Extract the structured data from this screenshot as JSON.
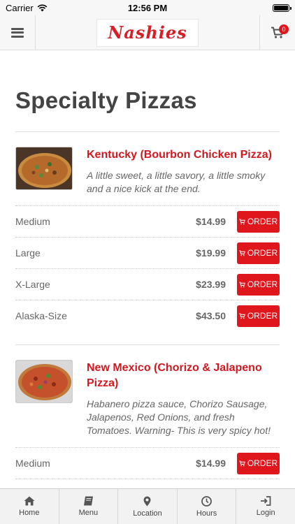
{
  "status_bar": {
    "carrier": "Carrier",
    "time": "12:56 PM"
  },
  "header": {
    "logo_text": "Nashies",
    "cart_count": "0"
  },
  "page": {
    "title": "Specialty Pizzas"
  },
  "items": [
    {
      "name": "Kentucky (Bourbon Chicken Pizza)",
      "description": "A little sweet, a little savory, a little smoky and a nice kick at the end.",
      "sizes": [
        {
          "name": "Medium",
          "price": "$14.99",
          "button": "ORDER"
        },
        {
          "name": "Large",
          "price": "$19.99",
          "button": "ORDER"
        },
        {
          "name": "X-Large",
          "price": "$23.99",
          "button": "ORDER"
        },
        {
          "name": "Alaska-Size",
          "price": "$43.50",
          "button": "ORDER"
        }
      ]
    },
    {
      "name": "New Mexico (Chorizo & Jalapeno Pizza)",
      "description": "Habanero pizza sauce, Chorizo Sausage, Jalapenos, Red Onions, and fresh Tomatoes. Warning- This is very spicy hot!",
      "sizes": [
        {
          "name": "Medium",
          "price": "$14.99",
          "button": "ORDER"
        }
      ]
    }
  ],
  "tabs": [
    {
      "label": "Home",
      "icon": "home-icon"
    },
    {
      "label": "Menu",
      "icon": "book-icon"
    },
    {
      "label": "Location",
      "icon": "map-pin-icon"
    },
    {
      "label": "Hours",
      "icon": "clock-icon"
    },
    {
      "label": "Login",
      "icon": "login-icon"
    }
  ],
  "colors": {
    "accent": "#e0161d",
    "title": "#444444",
    "item_name": "#d4171e"
  }
}
